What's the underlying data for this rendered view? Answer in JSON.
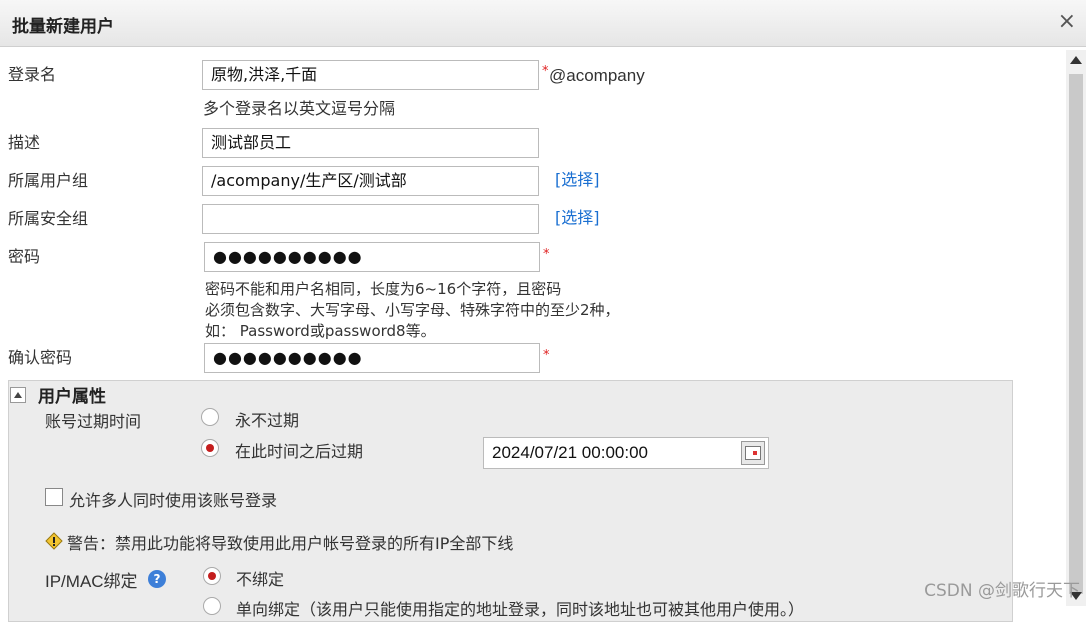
{
  "dialog": {
    "title": "批量新建用户",
    "close": "×"
  },
  "form": {
    "login": {
      "label": "登录名",
      "value": "原物,洪泽,千面",
      "required_mark": "*",
      "suffix": "@acompany",
      "hint": "多个登录名以英文逗号分隔"
    },
    "desc": {
      "label": "描述",
      "value": "测试部员工"
    },
    "group": {
      "label": "所属用户组",
      "value": "/acompany/生产区/测试部",
      "select": "[选择]"
    },
    "security": {
      "label": "所属安全组",
      "value": "",
      "select": "[选择]"
    },
    "password": {
      "label": "密码",
      "value": "●●●●●●●●●●",
      "required_mark": "*",
      "hint_lines": [
        "密码不能和用户名相同，长度为6~16个字符，且密码",
        "必须包含数字、大写字母、小写字母、特殊字符中的至少2种，",
        "如： Password或password8等。"
      ]
    },
    "confirm": {
      "label": "确认密码",
      "value": "●●●●●●●●●●",
      "required_mark": "*"
    }
  },
  "attributes": {
    "title": "用户属性",
    "expiry_label": "账号过期时间",
    "never": "永不过期",
    "after": "在此时间之后过期",
    "date": "2024/07/21 00:00:00",
    "multi_login": "允许多人同时使用该账号登录",
    "warning": "警告：禁用此功能将导致使用此用户帐号登录的所有IP全部下线",
    "ipmac_label": "IP/MAC绑定",
    "help": "?",
    "no_bind": "不绑定",
    "one_way": "单向绑定（该用户只能使用指定的地址登录，同时该地址也可被其他用户使用。）"
  },
  "watermark": "CSDN @剑歌行天下",
  "colors": {
    "link": "#1a6fd1",
    "required": "#e02020",
    "radio_selected": "#c41e1e"
  }
}
